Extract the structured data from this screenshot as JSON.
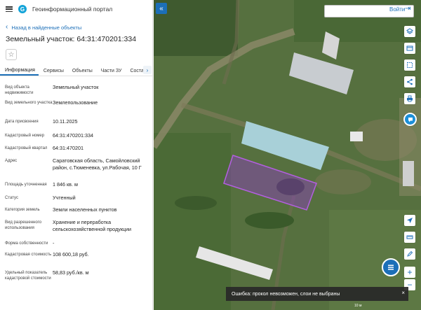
{
  "app": {
    "title": "Геоинформационный портал"
  },
  "nav": {
    "back_label": "Назад в найденные объекты"
  },
  "object": {
    "title": "Земельный участок: 64:31:470201:334"
  },
  "tabs": [
    "Информация",
    "Сервисы",
    "Объекты",
    "Части ЗУ",
    "Состав"
  ],
  "properties": [
    {
      "label": "Вид объекта недвижимости",
      "value": "Земельный участок"
    },
    {
      "label": "Вид земельного участка",
      "value": "Землепользование"
    },
    {
      "label": "Дата присвоения",
      "value": "10.11.2025"
    },
    {
      "label": "Кадастровый номер",
      "value": "64:31:470201:334"
    },
    {
      "label": "Кадастровый квартал",
      "value": "64:31:470201"
    },
    {
      "label": "Адрес",
      "value": "Саратовская область, Самойловский район, с.Тюменевка, ул.Рабочая, 10 Г"
    },
    {
      "label": "Площадь уточненная",
      "value": "1 846 кв. м"
    },
    {
      "label": "Статус",
      "value": "Учтенный"
    },
    {
      "label": "Категория земель",
      "value": "Земли населенных пунктов"
    },
    {
      "label": "Вид разрешенного использования",
      "value": "Хранение и переработка сельскохозяйственной продукции"
    },
    {
      "label": "Форма собственности",
      "value": "-"
    },
    {
      "label": "Кадастровая стоимость",
      "value": "108 600,18 руб."
    },
    {
      "label": "Удельный показатель кадастровой стоимости",
      "value": "58,83 руб./кв. м"
    }
  ],
  "map": {
    "login_label": "Войти",
    "toast_message": "Ошибка: прокол невозможен, слои не выбраны",
    "toast_close": "×",
    "zoom_in": "+",
    "zoom_out": "−",
    "scale_label": "10 м",
    "colors": {
      "accent": "#1c6fb8",
      "parcel": "#8e3fc4"
    }
  },
  "icons": {
    "menu": "hamburger-icon",
    "collapse": "double-chevron-left-icon",
    "layers": "layers-icon",
    "basemap": "basemap-icon",
    "select": "select-area-icon",
    "share": "share-icon",
    "print": "print-icon",
    "help": "chat-icon",
    "locate": "locate-arrow-icon",
    "ruler": "measure-icon",
    "draw": "draw-icon",
    "list": "list-icon"
  }
}
